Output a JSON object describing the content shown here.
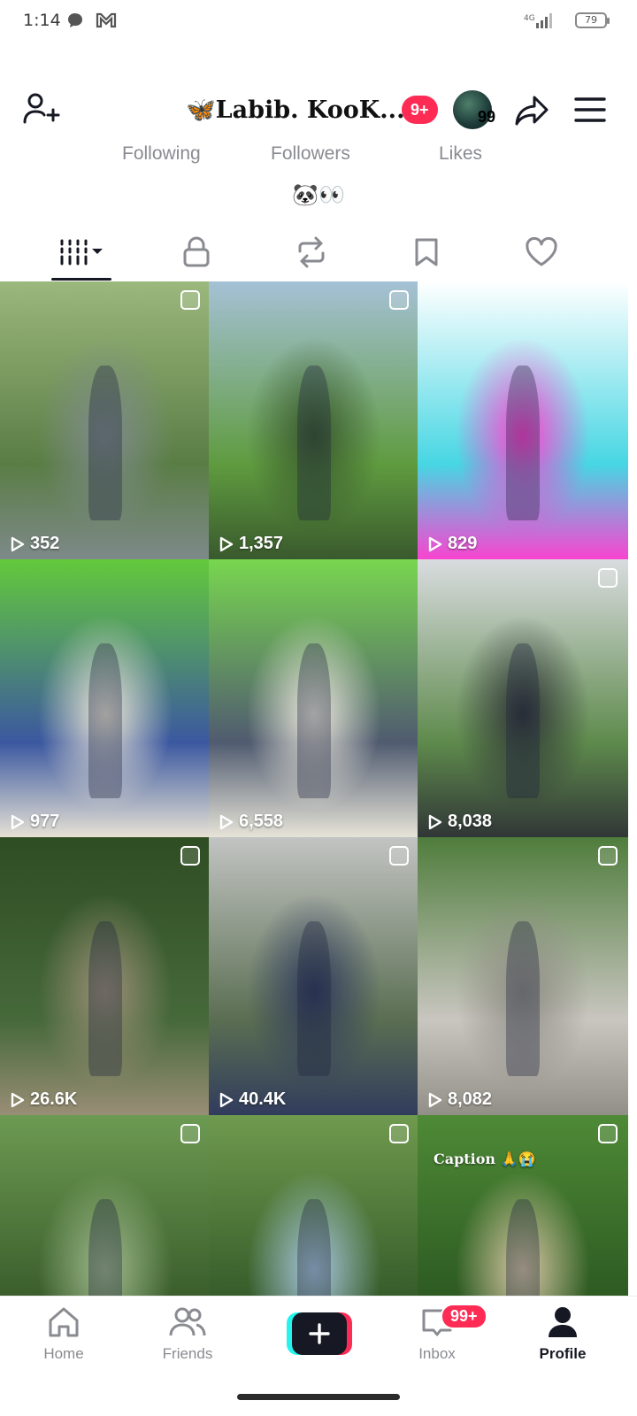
{
  "status_bar": {
    "time": "1:14",
    "network": "4G",
    "battery": "79",
    "icons": [
      "chat-bubble-icon",
      "gmail-icon",
      "signal-icon",
      "battery-icon"
    ]
  },
  "header": {
    "name": "🦋Labib. KooK...",
    "notification_badge": "9+",
    "story_count": "99"
  },
  "stats": {
    "following_label": "Following",
    "followers_label": "Followers",
    "likes_label": "Likes"
  },
  "bio": "🐼👀",
  "tabs": [
    "videos-grid",
    "private",
    "reposts",
    "favorites",
    "liked"
  ],
  "grid": [
    {
      "views": "352",
      "multi": true,
      "colors": [
        "#9bb87d",
        "#5a7d45",
        "#7f8a8c"
      ]
    },
    {
      "views": "1,357",
      "multi": true,
      "colors": [
        "#a5c1d6",
        "#5f9b3f",
        "#38572c"
      ]
    },
    {
      "views": "829",
      "multi": false,
      "colors": [
        "#ffffff",
        "#47d6e3",
        "#ff3fcf"
      ]
    },
    {
      "views": "977",
      "multi": false,
      "colors": [
        "#63c93b",
        "#3b58a0",
        "#ece6d6"
      ]
    },
    {
      "views": "6,558",
      "multi": false,
      "colors": [
        "#78d64f",
        "#505b70",
        "#ece9dc"
      ]
    },
    {
      "views": "8,038",
      "multi": true,
      "colors": [
        "#d9dcdf",
        "#5e8a4c",
        "#2f3336"
      ]
    },
    {
      "views": "26.6K",
      "multi": true,
      "colors": [
        "#2f4d23",
        "#46693a",
        "#9c8f78"
      ]
    },
    {
      "views": "40.4K",
      "multi": true,
      "colors": [
        "#c2c4c2",
        "#5a6e52",
        "#2f3a5d"
      ]
    },
    {
      "views": "8,082",
      "multi": true,
      "colors": [
        "#4f7d3c",
        "#c9c6c0",
        "#8f8d84"
      ]
    },
    {
      "views": "",
      "multi": true,
      "colors": [
        "#6c9a52",
        "#3b5e2c",
        "#a0b98e"
      ]
    },
    {
      "views": "",
      "multi": true,
      "colors": [
        "#6f9a4e",
        "#365c2a",
        "#a8c6de"
      ]
    },
    {
      "views": "",
      "multi": true,
      "caption": "Caption 🙏😭",
      "colors": [
        "#4e8a36",
        "#2d5a22",
        "#d9c7a5"
      ]
    }
  ],
  "bottom_nav": {
    "home": "Home",
    "friends": "Friends",
    "inbox": "Inbox",
    "inbox_badge": "99+",
    "profile": "Profile"
  }
}
